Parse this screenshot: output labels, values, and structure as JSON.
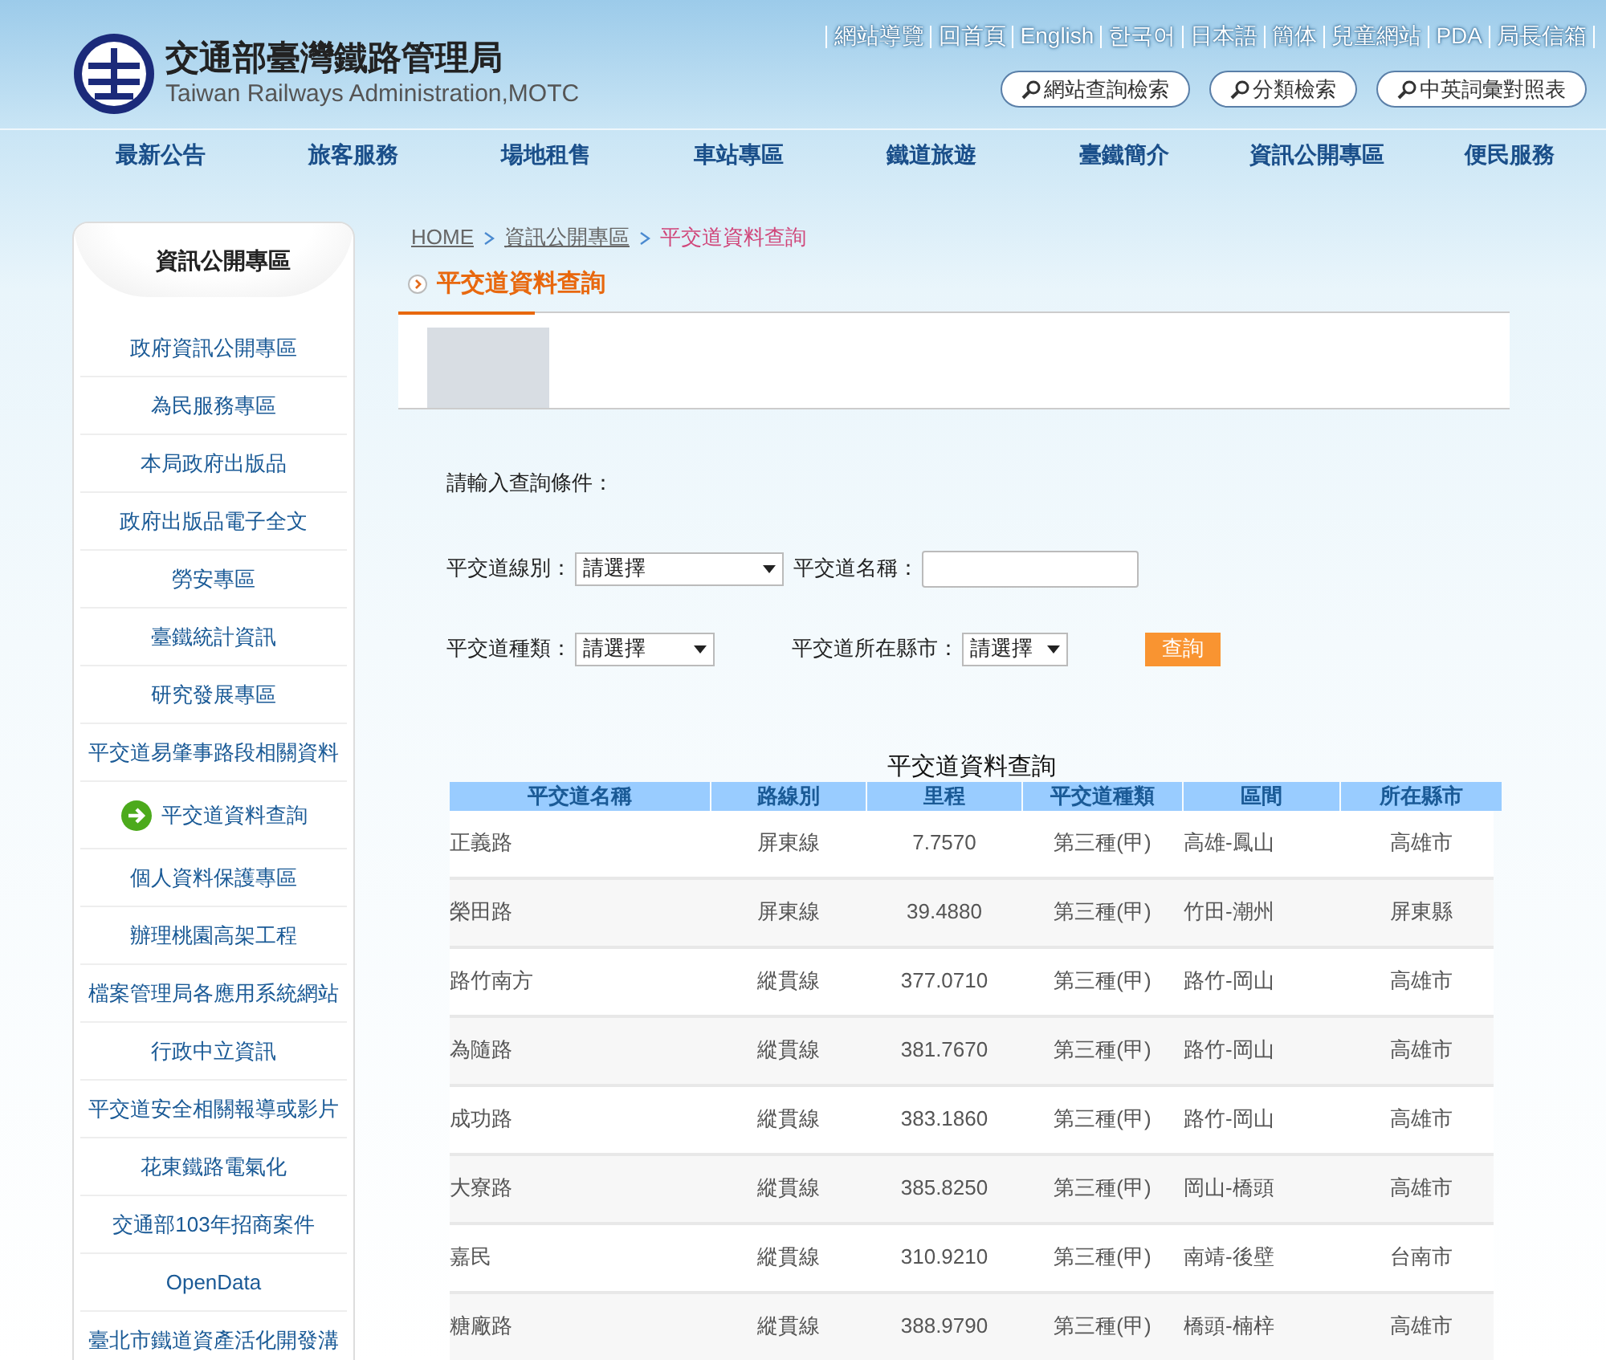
{
  "header": {
    "org_name": "交通部臺灣鐵路管理局",
    "org_name_en": "Taiwan Railways Administration,MOTC",
    "top_links": [
      "網站導覽",
      "回首頁",
      "English",
      "한국어",
      "日本語",
      "簡体",
      "兒童網站",
      "PDA",
      "局長信箱"
    ],
    "search_buttons": [
      "網站查詢檢索",
      "分類檢索",
      "中英詞彙對照表"
    ]
  },
  "main_nav": [
    "最新公告",
    "旅客服務",
    "場地租售",
    "車站專區",
    "鐵道旅遊",
    "臺鐵簡介",
    "資訊公開專區",
    "便民服務"
  ],
  "sidebar": {
    "title": "資訊公開專區",
    "items": [
      {
        "label": "政府資訊公開專區",
        "selected": false
      },
      {
        "label": "為民服務專區",
        "selected": false
      },
      {
        "label": "本局政府出版品",
        "selected": false
      },
      {
        "label": "政府出版品電子全文",
        "selected": false
      },
      {
        "label": "勞安專區",
        "selected": false
      },
      {
        "label": "臺鐵統計資訊",
        "selected": false
      },
      {
        "label": "研究發展專區",
        "selected": false
      },
      {
        "label": "平交道易肇事路段相關資料",
        "selected": false
      },
      {
        "label": "平交道資料查詢",
        "selected": true
      },
      {
        "label": "個人資料保護專區",
        "selected": false
      },
      {
        "label": "辦理桃園高架工程",
        "selected": false
      },
      {
        "label": "檔案管理局各應用系統網站",
        "selected": false
      },
      {
        "label": "行政中立資訊",
        "selected": false
      },
      {
        "label": "平交道安全相關報導或影片",
        "selected": false
      },
      {
        "label": "花東鐵路電氣化",
        "selected": false
      },
      {
        "label": "交通部103年招商案件",
        "selected": false
      },
      {
        "label": "OpenData",
        "selected": false
      },
      {
        "label": "臺北市鐵道資產活化開發溝",
        "selected": false
      }
    ]
  },
  "breadcrumb": [
    {
      "label": "HOME",
      "kind": "link"
    },
    {
      "label": "資訊公開專區",
      "kind": "link"
    },
    {
      "label": "平交道資料查詢",
      "kind": "current"
    }
  ],
  "page_title": "平交道資料查詢",
  "form": {
    "prompt": "請輸入查詢條件：",
    "line_label": "平交道線別：",
    "line_value": "請選擇",
    "name_label": "平交道名稱：",
    "type_label": "平交道種類：",
    "type_value": "請選擇",
    "city_label": "平交道所在縣市：",
    "city_value": "請選擇",
    "submit": "查詢"
  },
  "table": {
    "caption": "平交道資料查詢",
    "columns": [
      "平交道名稱",
      "路線別",
      "里程",
      "平交道種類",
      "區間",
      "所在縣市"
    ],
    "rows": [
      [
        "正義路",
        "屏東線",
        "7.7570",
        "第三種(甲)",
        "高雄-鳳山",
        "高雄市"
      ],
      [
        "榮田路",
        "屏東線",
        "39.4880",
        "第三種(甲)",
        "竹田-潮州",
        "屏東縣"
      ],
      [
        "路竹南方",
        "縱貫線",
        "377.0710",
        "第三種(甲)",
        "路竹-岡山",
        "高雄市"
      ],
      [
        "為隨路",
        "縱貫線",
        "381.7670",
        "第三種(甲)",
        "路竹-岡山",
        "高雄市"
      ],
      [
        "成功路",
        "縱貫線",
        "383.1860",
        "第三種(甲)",
        "路竹-岡山",
        "高雄市"
      ],
      [
        "大寮路",
        "縱貫線",
        "385.8250",
        "第三種(甲)",
        "岡山-橋頭",
        "高雄市"
      ],
      [
        "嘉民",
        "縱貫線",
        "310.9210",
        "第三種(甲)",
        "南靖-後壁",
        "台南市"
      ],
      [
        "糖廠路",
        "縱貫線",
        "388.9790",
        "第三種(甲)",
        "橋頭-楠梓",
        "高雄市"
      ]
    ]
  }
}
